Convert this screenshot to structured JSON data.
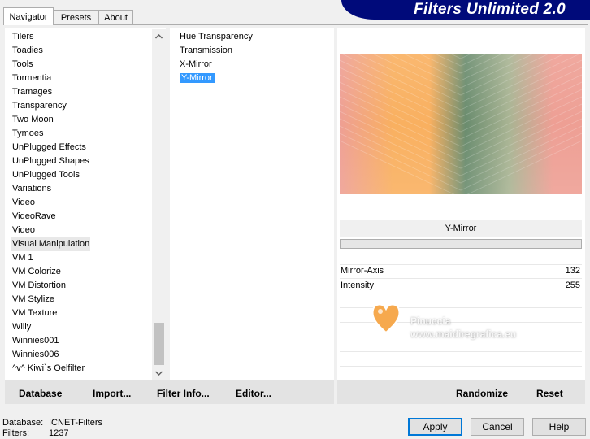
{
  "app": {
    "title": "Filters Unlimited 2.0"
  },
  "tabs": [
    {
      "label": "Navigator",
      "active": true
    },
    {
      "label": "Presets",
      "active": false
    },
    {
      "label": "About",
      "active": false
    }
  ],
  "categories": {
    "items": [
      "Tilers",
      "Toadies",
      "Tools",
      "Tormentia",
      "Tramages",
      "Transparency",
      "Two Moon",
      "Tymoes",
      "UnPlugged Effects",
      "UnPlugged Shapes",
      "UnPlugged Tools",
      "Variations",
      "Video",
      "VideoRave",
      "Video",
      "Visual Manipulation",
      "VM 1",
      "VM Colorize",
      "VM Distortion",
      "VM Stylize",
      "VM Texture",
      "Willy",
      "Winnies001",
      "Winnies006",
      "^v^ Kiwi`s Oelfilter"
    ],
    "selected_index": 15
  },
  "filters": {
    "items": [
      "Hue Transparency",
      "Transmission",
      "X-Mirror",
      "Y-Mirror"
    ],
    "selected_index": 3
  },
  "preview": {
    "colors": {
      "pink": "#ee9f94",
      "orange": "#f9b060",
      "green": "#6a8c6e",
      "sage": "#a9b493"
    }
  },
  "control": {
    "title": "Y-Mirror",
    "params": [
      {
        "label": "Mirror-Axis",
        "value": "132"
      },
      {
        "label": "Intensity",
        "value": "255"
      }
    ]
  },
  "bottom_bar": {
    "database": "Database",
    "import": "Import...",
    "filter_info": "Filter Info...",
    "editor": "Editor...",
    "randomize": "Randomize",
    "reset": "Reset"
  },
  "footer": {
    "db_label": "Database:",
    "db_value": "ICNET-Filters",
    "filters_label": "Filters:",
    "filters_value": "1237",
    "apply": "Apply",
    "cancel": "Cancel",
    "help": "Help"
  },
  "watermark": {
    "line1": "Pinuccia",
    "line2": "www.maidiregrafica.eu"
  },
  "colors": {
    "banner": "#000a7a",
    "selection": "#3399ff",
    "focus": "#0078d7"
  },
  "icons": [
    "scroll-up-arrow",
    "scroll-down-arrow",
    "heart-watermark"
  ]
}
